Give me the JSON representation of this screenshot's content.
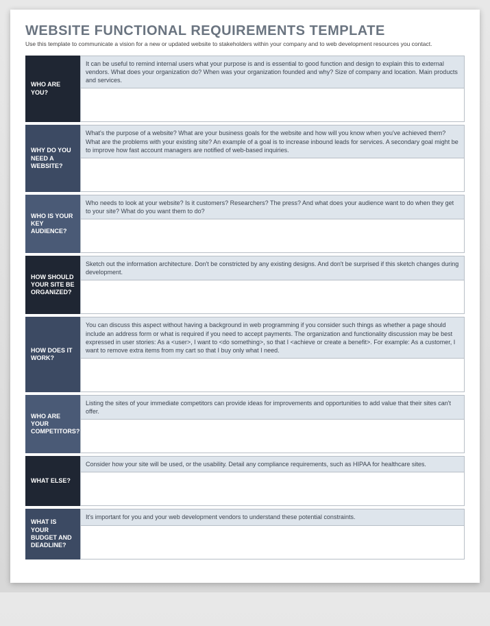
{
  "title": "WEBSITE FUNCTIONAL REQUIREMENTS TEMPLATE",
  "subtitle": "Use this template to communicate a vision for a new or updated website to stakeholders within your company and to web development resources you contact.",
  "label_colors": [
    "#1f2633",
    "#3c4a63",
    "#4a5a76",
    "#1f2633",
    "#3c4a63",
    "#4a5a76",
    "#1f2633",
    "#3c4a63"
  ],
  "sections": [
    {
      "label": "WHO ARE YOU?",
      "hint": "It can be useful to remind internal users what your purpose is and is essential to good function and design to explain this to external vendors. What does your organization do? When was your organization founded and why? Size of company and location. Main products and services."
    },
    {
      "label": "WHY DO YOU NEED A WEBSITE?",
      "hint": "What's the purpose of a website? What are your business goals for the website and how will you know when you've achieved them? What are the problems with your existing site? An example of a goal is to increase inbound leads for services. A secondary goal might be to improve how fast account managers are notified of web-based inquiries."
    },
    {
      "label": "WHO IS YOUR KEY AUDIENCE?",
      "hint": "Who needs to look at your website? Is it customers? Researchers? The press? And what does your audience want to do when they get to your site? What do you want them to do?"
    },
    {
      "label": "HOW SHOULD YOUR SITE BE ORGANIZED?",
      "hint": "Sketch out the information architecture. Don't be constricted by any existing designs. And don't be surprised if this sketch changes during development."
    },
    {
      "label": "HOW DOES IT WORK?",
      "hint": "You can discuss this aspect without having a background in web programming if you consider such things as whether a page should include an address form or what is required if you need to accept payments. The organization and functionality discussion may be best expressed in user stories: As a <user>, I want to <do something>, so that I <achieve or create a benefit>. For example:  As a customer, I want to remove extra items from my cart so that I buy only what I need."
    },
    {
      "label": "WHO ARE YOUR COMPETITORS?",
      "hint": "Listing the sites of your immediate competitors can provide ideas for improvements and opportunities to add value that their sites can't offer."
    },
    {
      "label": "WHAT ELSE?",
      "hint": "Consider how your site will be used, or the usability. Detail any compliance requirements, such as HIPAA for healthcare sites."
    },
    {
      "label": "WHAT IS YOUR BUDGET AND DEADLINE?",
      "hint": "It's important for you and your web development vendors to understand these potential constraints."
    }
  ]
}
